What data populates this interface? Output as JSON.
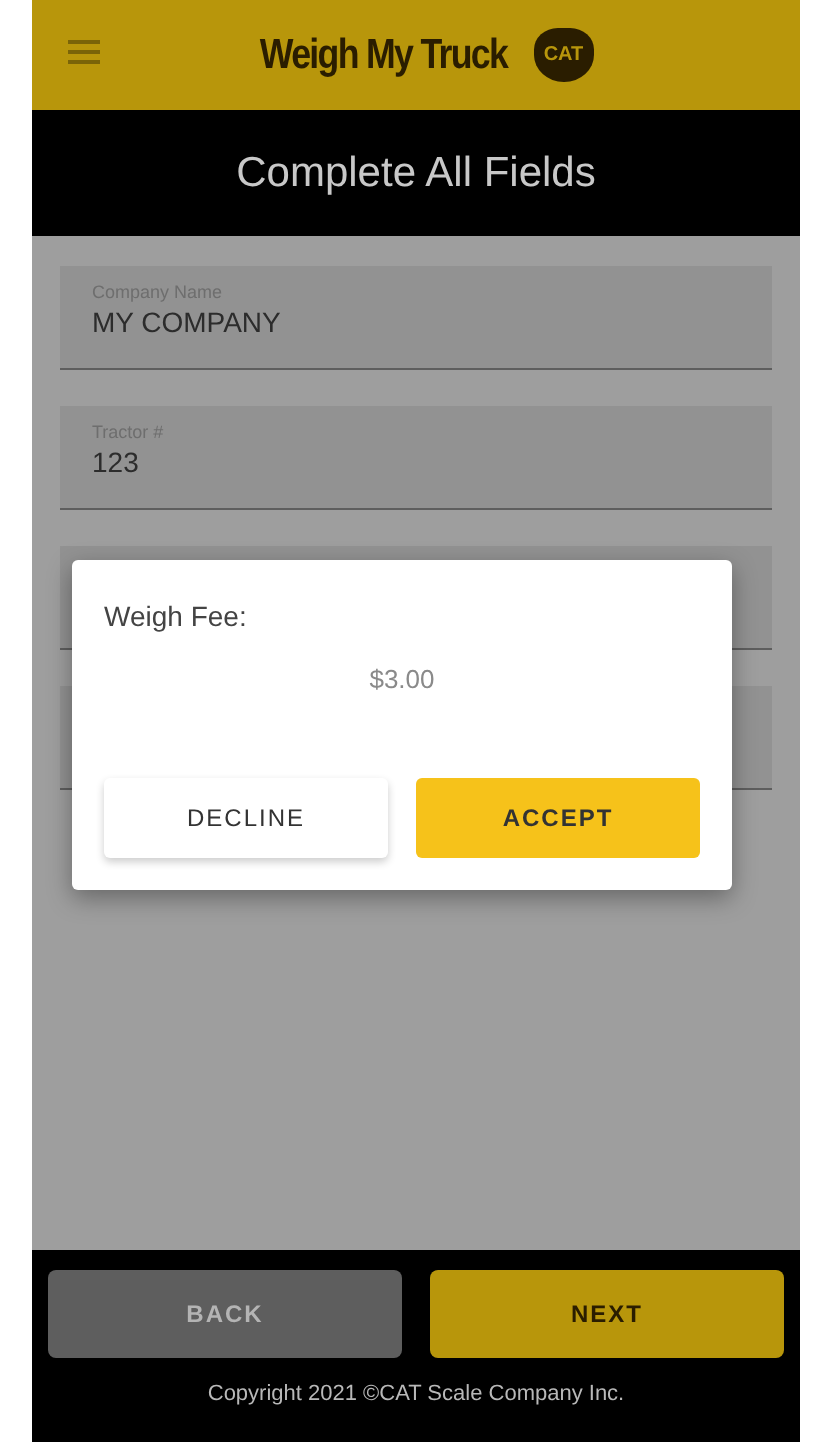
{
  "header": {
    "logo_text": "Weigh My Truck",
    "logo_badge": "CAT"
  },
  "title": "Complete All Fields",
  "fields": [
    {
      "kind": "text",
      "label": "Company Name",
      "value": "MY COMPANY"
    },
    {
      "kind": "text",
      "label": "Tractor #",
      "value": "123"
    },
    {
      "kind": "covered"
    },
    {
      "kind": "covered"
    }
  ],
  "dialog": {
    "title": "Weigh Fee:",
    "amount": "$3.00",
    "buttons": [
      {
        "label": "DECLINE",
        "kind": "secondary"
      },
      {
        "label": "ACCEPT",
        "kind": "primary"
      }
    ]
  },
  "footer": {
    "buttons": [
      {
        "label": "BACK",
        "disabled": true
      },
      {
        "label": "NEXT",
        "disabled": false
      }
    ],
    "copyright": "Copyright 2021 ©CAT Scale Company Inc."
  }
}
